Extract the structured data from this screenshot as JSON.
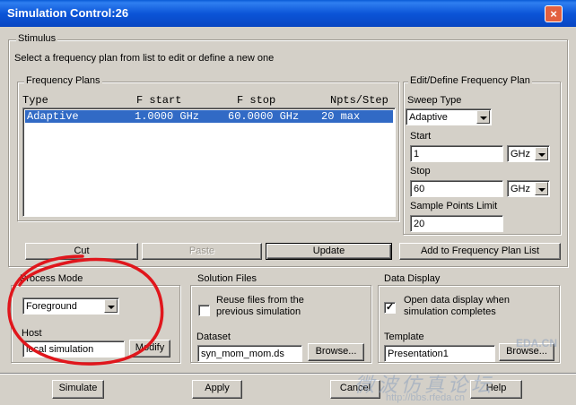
{
  "window": {
    "title": "Simulation Control:26",
    "close_label": "×"
  },
  "stimulus": {
    "legend": "Stimulus",
    "instruction": "Select a frequency plan from list to edit or define a new one"
  },
  "frequency_plans": {
    "legend": "Frequency Plans",
    "columns": [
      "Type",
      "F start",
      "F stop",
      "Npts/Step"
    ],
    "rows": [
      {
        "type": "Adaptive",
        "fstart": "1.0000 GHz",
        "fstop": "60.0000 GHz",
        "npts": "20 max",
        "selected": true
      }
    ]
  },
  "edit_define": {
    "legend": "Edit/Define Frequency Plan",
    "sweep_type_label": "Sweep Type",
    "sweep_type_value": "Adaptive",
    "start_label": "Start",
    "start_value": "1",
    "start_unit": "GHz",
    "stop_label": "Stop",
    "stop_value": "60",
    "stop_unit": "GHz",
    "sample_points_label": "Sample Points Limit",
    "sample_points_value": "20"
  },
  "plan_buttons": {
    "cut": "Cut",
    "paste": "Paste",
    "update": "Update",
    "add": "Add to Frequency Plan List"
  },
  "process_mode": {
    "legend": "Process Mode",
    "mode_value": "Foreground",
    "host_label": "Host",
    "host_value": "local simulation",
    "modify_label": "Modify"
  },
  "solution_files": {
    "legend": "Solution Files",
    "reuse_label_line1": "Reuse files from the",
    "reuse_label_line2": "previous simulation",
    "reuse_checked": false,
    "dataset_label": "Dataset",
    "dataset_value": "syn_mom_mom.ds",
    "browse_label": "Browse..."
  },
  "data_display": {
    "legend": "Data Display",
    "open_label_line1": "Open data display when",
    "open_label_line2": "simulation completes",
    "open_checked": true,
    "template_label": "Template",
    "template_value": "Presentation1",
    "browse_label": "Browse..."
  },
  "bottom_buttons": {
    "simulate": "Simulate",
    "apply": "Apply",
    "cancel": "Cancel",
    "help": "Help"
  },
  "watermark": {
    "site_text": "EDA.CN",
    "chinese_text": "微波仿真论坛",
    "url_text": "http://bbs.rfeda.cn"
  },
  "colors": {
    "title_bar": "#0a5bd6",
    "dialog_bg": "#d4d0c8",
    "selection": "#316ac5",
    "annotation_red": "#e0161c"
  }
}
